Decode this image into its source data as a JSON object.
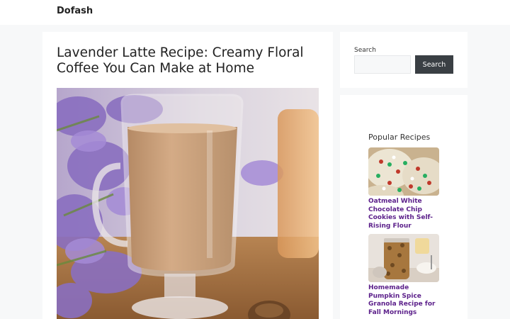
{
  "site": {
    "name": "Dofash"
  },
  "post": {
    "title": "Lavender Latte Recipe: Creamy Floral Coffee You Can Make at Home",
    "hero_image": "lavender-latte-photo"
  },
  "search": {
    "label": "Search",
    "placeholder": "",
    "button_label": "Search"
  },
  "popular": {
    "heading": "Popular Recipes",
    "items": [
      {
        "title": "Oatmeal White Chocolate Chip Cookies with Self-Rising Flour",
        "image": "cookies-photo"
      },
      {
        "title": "Homemade Pumpkin Spice Granola Recipe for Fall Mornings",
        "image": "granola-jar-photo"
      }
    ]
  },
  "colors": {
    "link": "#5b1f8a",
    "button": "#3a3f44",
    "background": "#f7f8f9"
  }
}
